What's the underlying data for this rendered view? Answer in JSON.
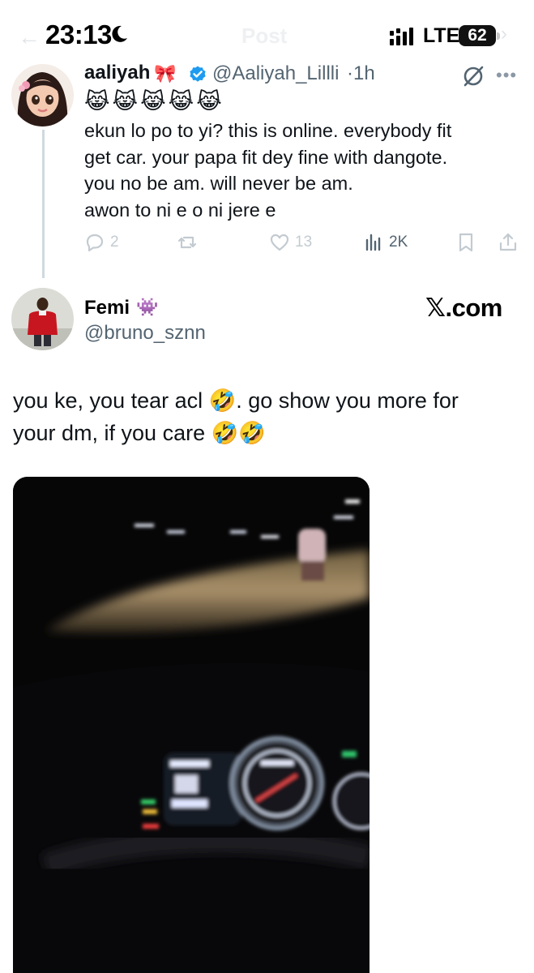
{
  "status_bar": {
    "time": "23:13",
    "header_title": "Post",
    "network": "LTE",
    "battery": "62",
    "moon_icon": "moon-icon",
    "signal_icon": "signal-icon"
  },
  "quoted_tweet": {
    "author_name": "aaliyah",
    "name_emoji": "🎀",
    "verified": true,
    "handle": "@Aaliyah_Lillli",
    "separator": "·",
    "timestamp": "1h",
    "emoji_row": "😹😹😹😹😹",
    "text_lines": [
      "ekun lo po to yi? this is online. everybody fit",
      "get car. your papa fit dey fine with dangote.",
      "you no be am. will never be am.",
      "awon to ni e o ni jere e"
    ],
    "replies": "2",
    "retweets": "",
    "likes": "13",
    "views": "2K"
  },
  "main_post": {
    "author_name": "Femi",
    "name_emoji": "👾",
    "handle": "@bruno_sznn",
    "brand": "𝕏.com",
    "text_lines": [
      "you ke, you tear acl 🤣. go show you more for",
      "your dm, if you care 🤣🤣"
    ],
    "media_type": "video"
  },
  "colors": {
    "text_primary": "#0f1419",
    "text_secondary": "#536471",
    "verified_blue": "#1d9bf0",
    "thread_line": "#cfd9de",
    "action_icons": "#c3cbd1"
  }
}
